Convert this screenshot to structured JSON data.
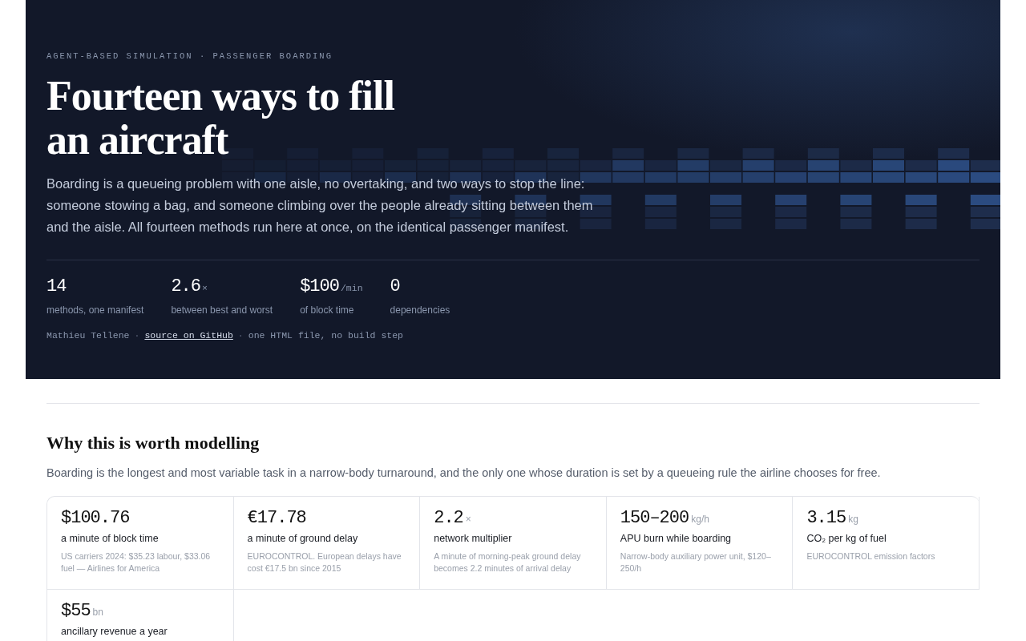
{
  "hero": {
    "eyebrow": "AGENT-BASED SIMULATION · PASSENGER BOARDING",
    "title_lines": [
      "Fourteen ways to fill",
      "an aircraft"
    ],
    "lede": "Boarding is a queueing problem with one aisle, no overtaking, and two ways to stop the line: someone stowing a bag, and someone climbing over the people already sitting between them and the aisle. All fourteen methods run here at once, on the identical passenger manifest.",
    "stats": [
      {
        "value": "14",
        "label": "methods, one manifest"
      },
      {
        "value": "2.6",
        "unit": "×",
        "label": "between best and worst"
      },
      {
        "value": "$100",
        "unit": "/min",
        "label": "of block time"
      },
      {
        "value": "0",
        "label": "dependencies"
      }
    ],
    "byline": {
      "author": "Mathieu Tellene",
      "separator": "·",
      "link": "source on GitHub",
      "note": "one HTML file, no build step"
    }
  },
  "section": {
    "heading": "Why this is worth modelling",
    "intro": "Boarding is the longest and most variable task in a narrow-body turnaround, and the only one whose duration is set by a queueing rule the airline chooses for free.",
    "facts": [
      {
        "value": "$100.76",
        "label": "a minute of block time",
        "source": "US carriers 2024: $35.23 labour, $33.06 fuel — Airlines for America"
      },
      {
        "value": "€17.78",
        "label": "a minute of ground delay",
        "source": "EUROCONTROL. European delays have cost €17.5 bn since 2015"
      },
      {
        "value": "2.2",
        "unit": "×",
        "label": "network multiplier",
        "source": "A minute of morning-peak ground delay becomes 2.2 minutes of arrival delay"
      },
      {
        "value": "150–200",
        "unit": "kg/h",
        "label": "APU burn while boarding",
        "source": "Narrow-body auxiliary power unit, $120–250/h"
      },
      {
        "value": "3.15",
        "unit": "kg",
        "label": "CO₂ per kg of fuel",
        "source": "EUROCONTROL emission factors"
      },
      {
        "value": "$55",
        "unit": "bn",
        "label": "ancillary revenue a year"
      }
    ]
  }
}
